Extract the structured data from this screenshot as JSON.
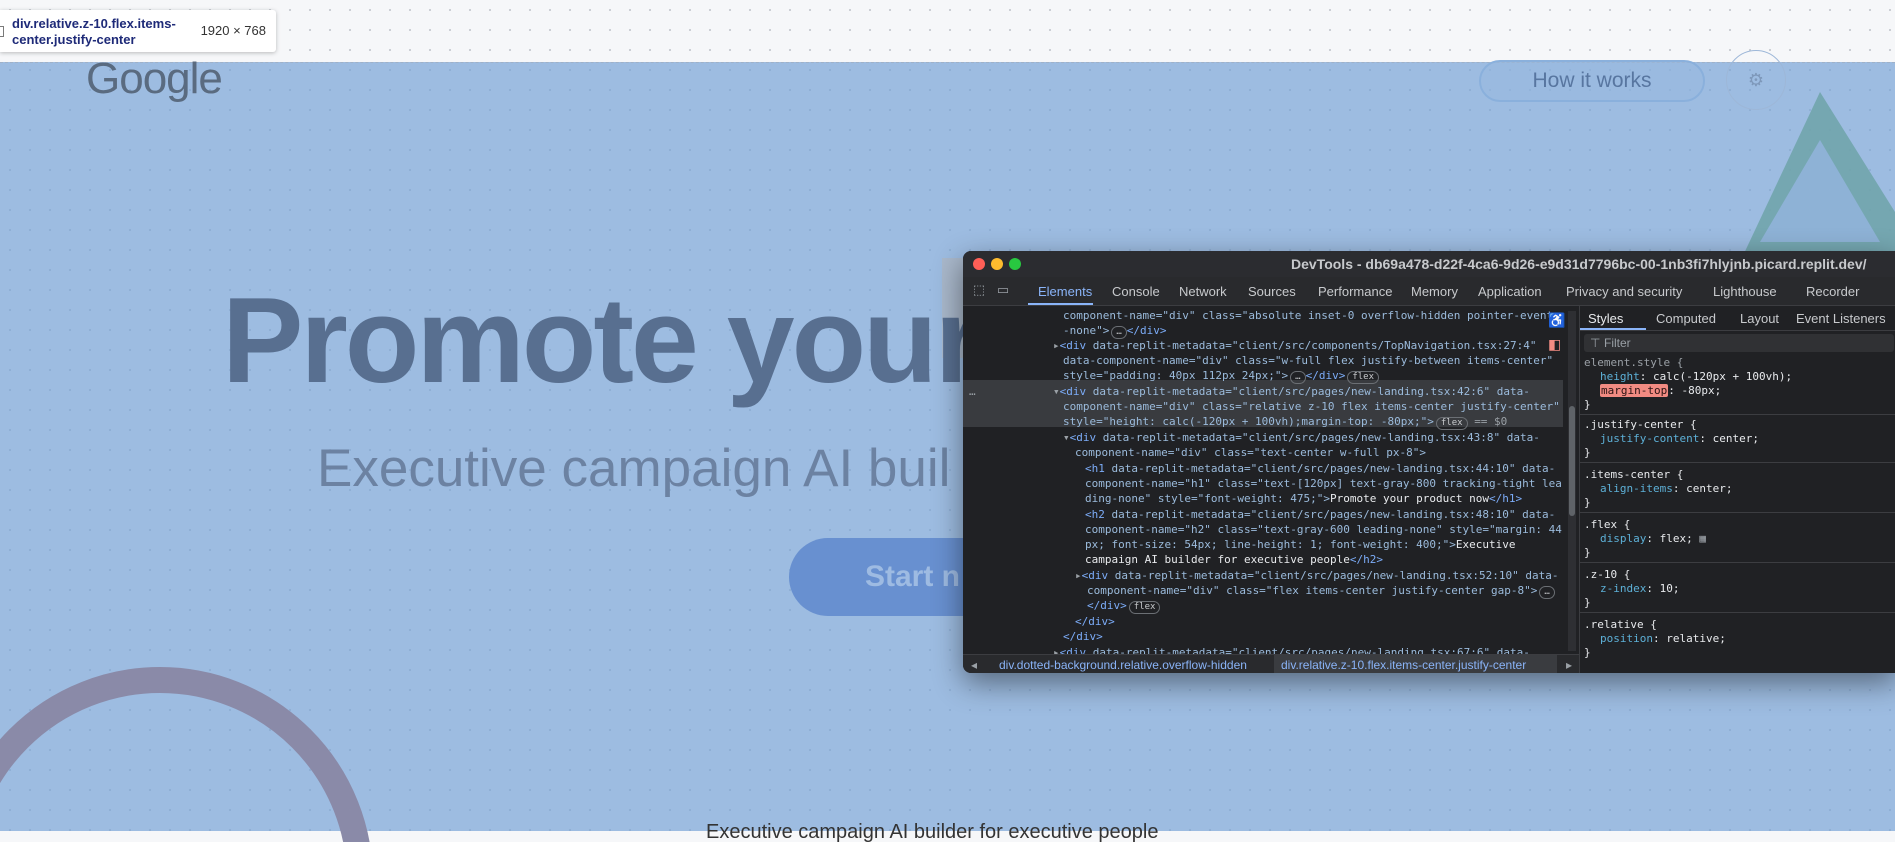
{
  "inspector_tooltip": {
    "selector": "div.relative.z-10.flex.items-center.justify-center",
    "dimensions": "1920 × 768"
  },
  "page": {
    "logo": "Google",
    "nav": {
      "how_it_works": "How it works",
      "settings_icon": "gear-icon"
    },
    "hero": {
      "title": "Promote your",
      "subtitle": "Executive campaign AI buil",
      "cta": "Start n",
      "footer_subtitle": "Executive campaign AI builder for executive people"
    },
    "colors": {
      "overlay": "#6f9ed5",
      "arc": "#8a8aa8",
      "triangle": "#6fa3a8",
      "cta": "#6890d0"
    }
  },
  "devtools": {
    "title": "DevTools - db69a478-d22f-4ca6-9d26-e9d31d7796bc-00-1nb3fi7hlyjnb.picard.replit.dev/",
    "tabs": [
      "Elements",
      "Console",
      "Network",
      "Sources",
      "Performance",
      "Memory",
      "Application",
      "Privacy and security",
      "Lighthouse",
      "Recorder"
    ],
    "active_tab": "Elements",
    "elements": {
      "l1a": "component-name=\"div\" class=\"absolute inset-0 overflow-hidden pointer-events",
      "l1b": "-none\">",
      "l1c": "</div>",
      "l2_attr": "data-replit-metadata=\"client/src/components/TopNavigation.tsx:27:4\"",
      "l2b": "data-component-name=\"div\" class=\"w-full flex justify-between items-center\"",
      "l2c": "style=\"padding: 40px 112px 24px;\">",
      "l2d": "</div>",
      "l3_attr": "data-replit-metadata=\"client/src/pages/new-landing.tsx:42:6\" data-",
      "l3b": "component-name=\"div\" class=\"relative z-10 flex items-center justify-center\"",
      "l3c": "style=\"height: calc(-120px + 100vh);margin-top: -80px;\">",
      "l3_eq": "== $0",
      "l4_attr": "data-replit-metadata=\"client/src/pages/new-landing.tsx:43:8\" data-",
      "l4b": "component-name=\"div\" class=\"text-center w-full px-8\">",
      "l5_attr": "data-replit-metadata=\"client/src/pages/new-landing.tsx:44:10\" data-",
      "l5b": "component-name=\"h1\" class=\"text-[120px] text-gray-800 tracking-tight lea",
      "l5c": "ding-none\" style=\"font-weight: 475;\">",
      "l5_text": "Promote your product now",
      "l6_attr": "data-replit-metadata=\"client/src/pages/new-landing.tsx:48:10\" data-",
      "l6b": "component-name=\"h2\" class=\"text-gray-600 leading-none\" style=\"margin: 44",
      "l6c": "px; font-size: 54px; line-height: 1; font-weight: 400;\">",
      "l6_text1": "Executive",
      "l6_text2": "campaign AI builder for executive people",
      "l7_attr": "data-replit-metadata=\"client/src/pages/new-landing.tsx:52:10\" data-",
      "l7b": "component-name=\"div\" class=\"flex items-center justify-center gap-8\">",
      "l7c": "</div>",
      "l8": "</div>",
      "l9": "</div>",
      "l10_attr": "data-replit-metadata=\"client/src/pages/new-landing.tsx:67:6\" data-",
      "badge_flex": "flex",
      "ellipsis": "…"
    },
    "breadcrumbs": [
      "div.dotted-background.relative.overflow-hidden",
      "div.relative.z-10.flex.items-center.justify-center"
    ],
    "styles_tabs": [
      "Styles",
      "Computed",
      "Layout",
      "Event Listeners"
    ],
    "filter_placeholder": "Filter",
    "rules": {
      "element_style": "element.style {",
      "height_prop": "height",
      "height_val": ": calc(-120px + 100vh);",
      "margin_prop": "margin-top",
      "margin_val": ": -80px;",
      "justify_sel": ".justify-center {",
      "justify_prop": "justify-content",
      "justify_val": ": center;",
      "items_sel": ".items-center {",
      "items_prop": "align-items",
      "items_val": ": center;",
      "flex_sel": ".flex {",
      "flex_prop": "display",
      "flex_val": ": flex;",
      "z_sel": ".z-10 {",
      "z_prop": "z-index",
      "z_val": ": 10;",
      "rel_sel": ".relative {",
      "rel_prop": "position",
      "rel_val": ": relative;",
      "close": "}"
    }
  }
}
